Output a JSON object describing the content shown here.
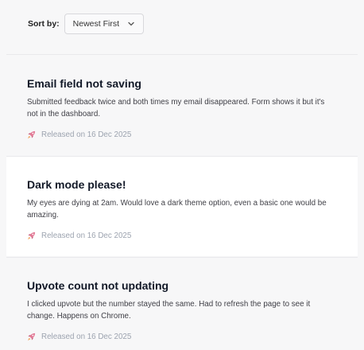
{
  "sort": {
    "label": "Sort by:",
    "value": "Newest First"
  },
  "items": [
    {
      "title": "Email field not saving",
      "body": "Submitted feedback twice and both times my email disappeared. Form shows it but it's not in the dashboard.",
      "release_icon": "rocket-icon",
      "release": "Released on 16 Dec 2025"
    },
    {
      "title": "Dark mode please!",
      "body": "My eyes are dying at 2am. Would love a dark theme option, even a basic one would be amazing.",
      "release_icon": "rocket-icon",
      "release": "Released on 16 Dec 2025"
    },
    {
      "title": "Upvote count not updating",
      "body": "I clicked upvote but the number stayed the same. Had to refresh the page to see it change. Happens on Chrome.",
      "release_icon": "rocket-icon",
      "release": "Released on 16 Dec 2025"
    }
  ],
  "colors": {
    "background": "#f7f7f8",
    "card_highlight": "#ffffff",
    "rocket_pink": "#e27a96",
    "muted_text": "#9ca3af"
  }
}
